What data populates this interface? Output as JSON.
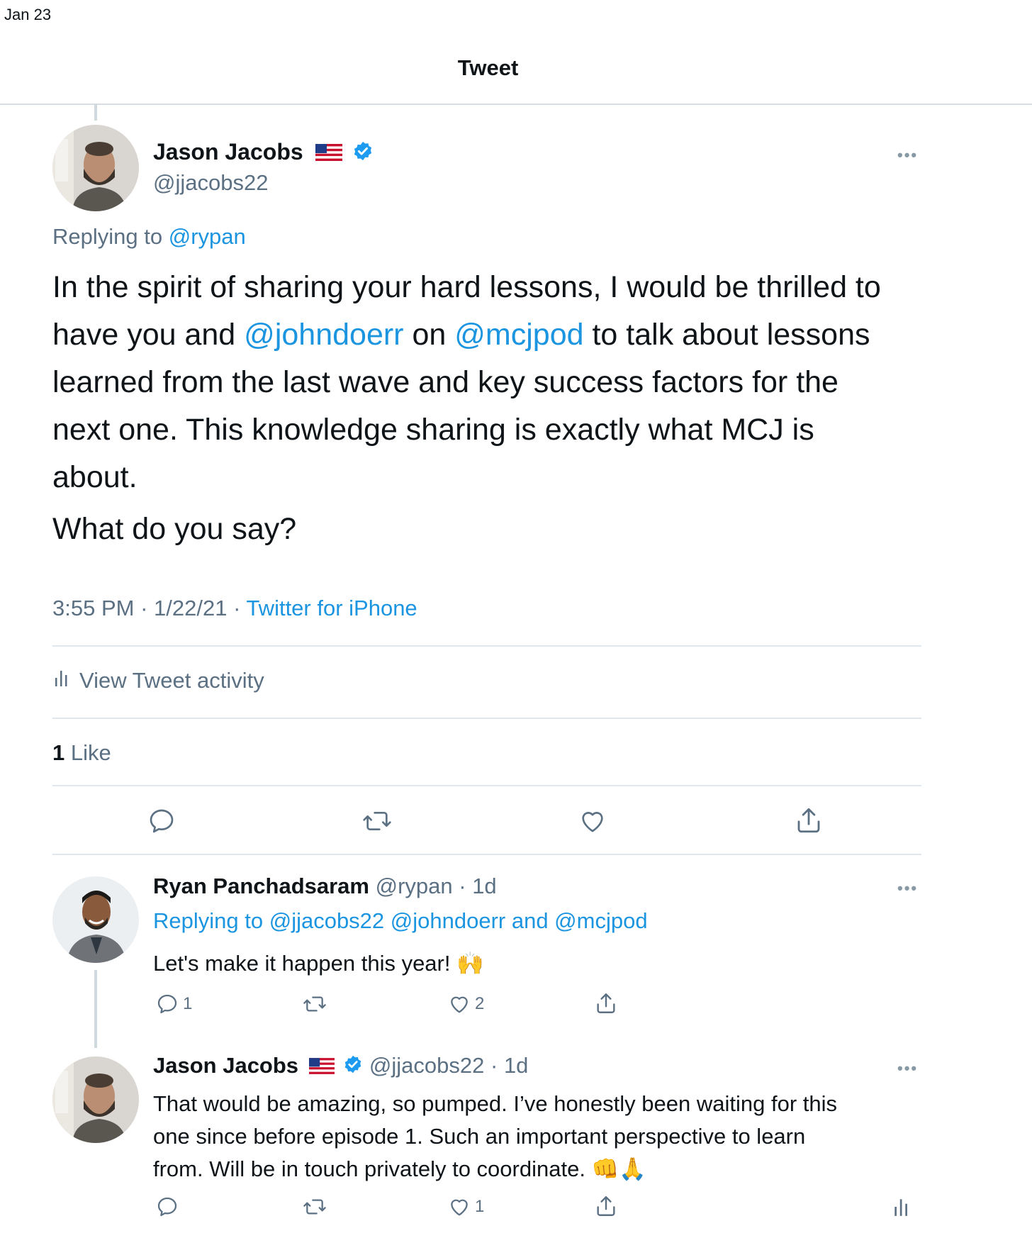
{
  "status_bar": {
    "date": "Jan 23"
  },
  "header": {
    "title": "Tweet"
  },
  "main_tweet": {
    "author_name": "Jason Jacobs",
    "handle": "@jjacobs22",
    "more": "•••",
    "replying_prefix": "Replying to",
    "replying_handle": "@rypan",
    "body": {
      "l1": "In the spirit of sharing your hard lessons, I would be thrilled to",
      "l2a": "have you and ",
      "l2b": "@johndoerr",
      "l2c": " on ",
      "l2d": "@mcjpod",
      "l2e": " to talk about lessons",
      "l3": "learned from the last wave and key success factors for the",
      "l4": "next one. This knowledge sharing is exactly what MCJ is",
      "l5": "about.",
      "p2": "What do you say?"
    },
    "time": "3:55 PM",
    "sep1": " · ",
    "date": "1/22/21",
    "sep2": " · ",
    "source": "Twitter for iPhone",
    "activity": "View Tweet activity",
    "like_count": "1",
    "like_label": " Like"
  },
  "reply1": {
    "author_name": "Ryan Panchadsaram",
    "handle": "@rypan",
    "sep": " · ",
    "age": "1d",
    "more": "•••",
    "replying_prefix": "Replying to ",
    "replying_handles": "@jjacobs22 @johndoerr and @mcjpod",
    "text": "Let's make it happen this year! 🙌",
    "reply_count": "1",
    "like_count": "2"
  },
  "reply2": {
    "author_name": "Jason Jacobs",
    "handle": "@jjacobs22",
    "sep": " · ",
    "age": "1d",
    "more": "•••",
    "l1": "That would be amazing, so pumped. I’ve honestly been waiting for this",
    "l2": "one since before episode 1. Such an important perspective to learn",
    "l3": "from. Will be in touch privately to coordinate. 👊🙏",
    "like_count": "1"
  },
  "colors": {
    "link": "#1b95e0",
    "secondary": "#5b7083",
    "divider": "#e1e8ed",
    "verified": "#1d9bf0"
  },
  "icons": [
    "reply-icon",
    "retweet-icon",
    "like-icon",
    "share-icon",
    "activity-icon",
    "verified-icon",
    "us-flag-icon",
    "more-icon"
  ]
}
